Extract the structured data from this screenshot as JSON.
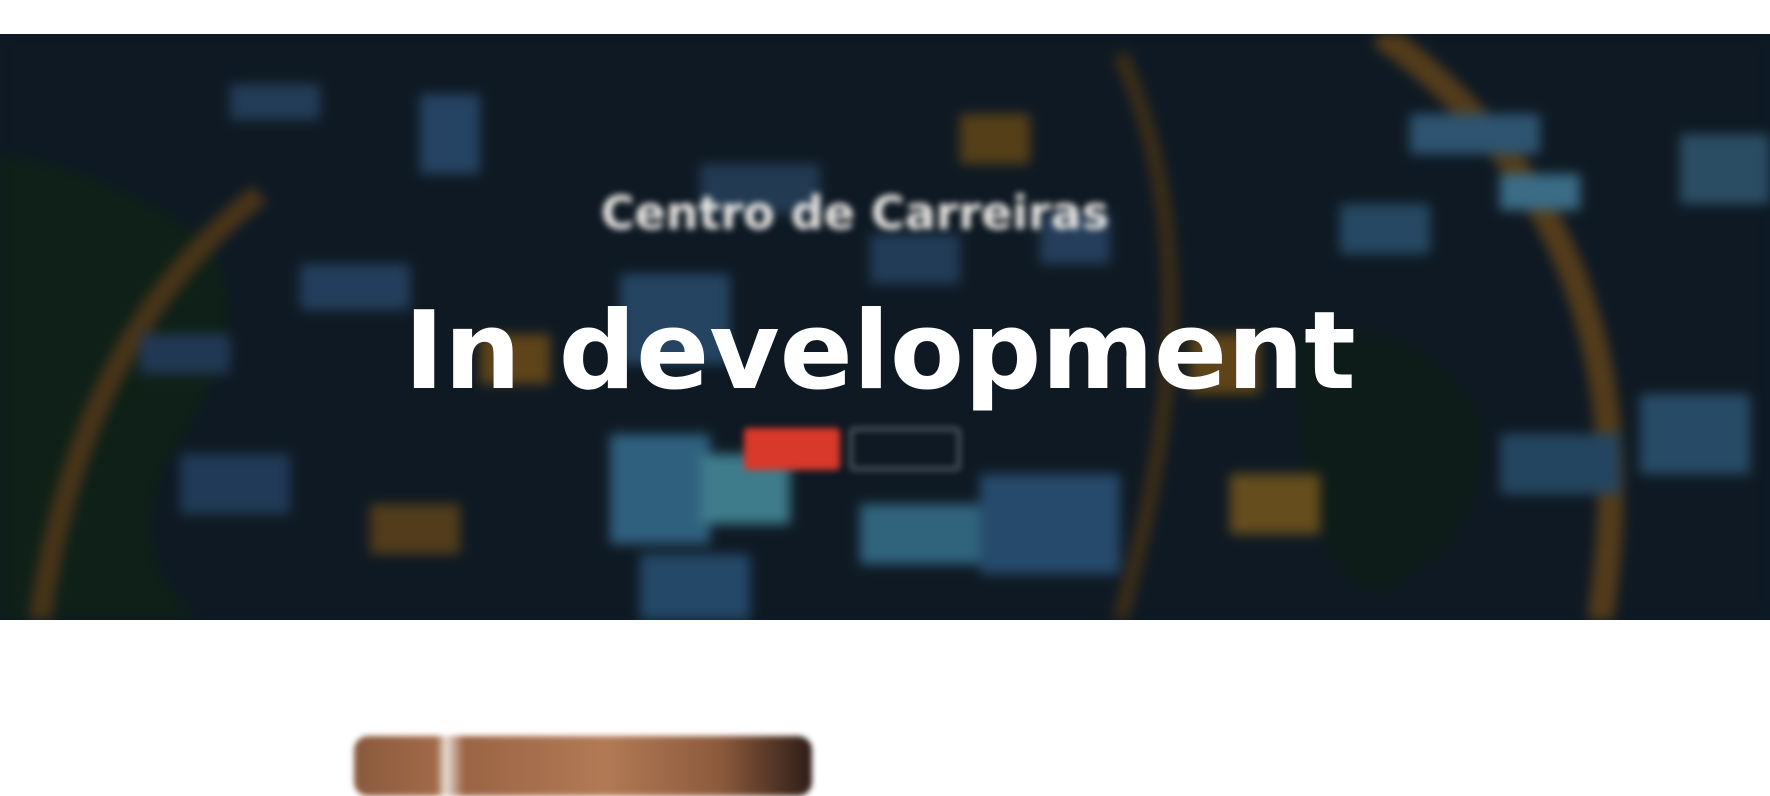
{
  "hero": {
    "title": "Centro de Carreiras",
    "subtitle_line1": "",
    "subtitle_line2": "",
    "primary_button_label": "",
    "secondary_button_label": ""
  },
  "overlay": {
    "text": "In development"
  },
  "colors": {
    "primary_button": "#d9392b",
    "hero_dark": "#0d1a26"
  }
}
